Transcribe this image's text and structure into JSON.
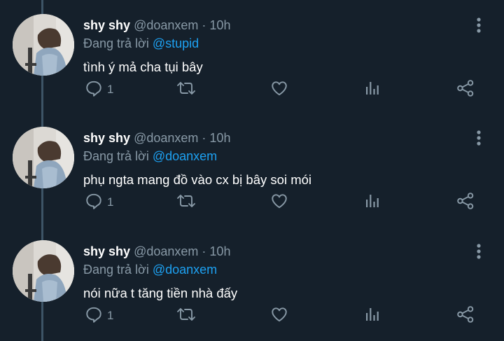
{
  "tweets": [
    {
      "display_name": "shy shy",
      "handle": "@doanxem",
      "separator": "·",
      "time": "10h",
      "reply_prefix": "Đang trả lời",
      "reply_to": "@stupid",
      "text": "tình ý mả cha tụi bây",
      "reply_count": "1"
    },
    {
      "display_name": "shy shy",
      "handle": "@doanxem",
      "separator": "·",
      "time": "10h",
      "reply_prefix": "Đang trả lời",
      "reply_to": "@doanxem",
      "text": "phụ ngta mang đồ vào cx bị bây soi mói",
      "reply_count": "1"
    },
    {
      "display_name": "shy shy",
      "handle": "@doanxem",
      "separator": "·",
      "time": "10h",
      "reply_prefix": "Đang trả lời",
      "reply_to": "@doanxem",
      "text": "nói nữa t tăng tiền nhà đấy",
      "reply_count": "1"
    }
  ],
  "icons": {
    "reply": "reply-icon",
    "retweet": "retweet-icon",
    "like": "heart-icon",
    "analytics": "analytics-icon",
    "share": "share-icon",
    "more": "more-vertical-icon"
  },
  "colors": {
    "background": "#15202b",
    "text": "#ffffff",
    "secondary": "#8899a6",
    "link": "#1da1f2",
    "thread_line": "#3d5466"
  }
}
